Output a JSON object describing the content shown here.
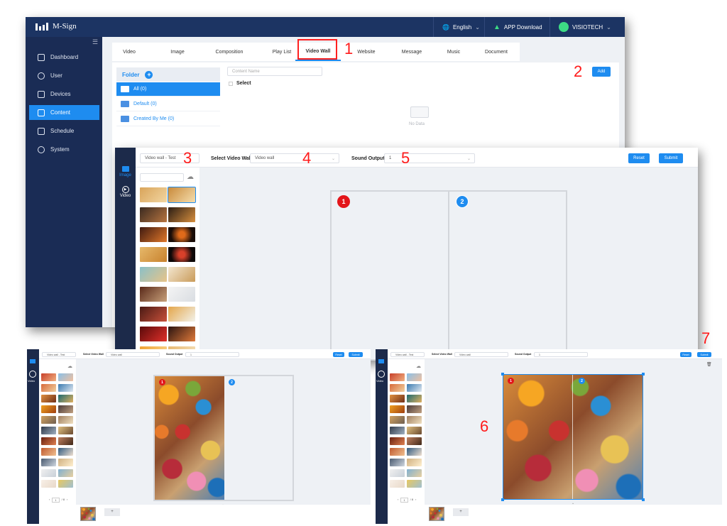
{
  "app": {
    "logo_text": "M-Sign",
    "language": "English",
    "app_download": "APP Download",
    "user": "VISIOTECH"
  },
  "sidebar": {
    "items": [
      {
        "label": "Dashboard",
        "icon": "grid-icon"
      },
      {
        "label": "User",
        "icon": "user-icon"
      },
      {
        "label": "Devices",
        "icon": "monitor-icon"
      },
      {
        "label": "Content",
        "icon": "image-icon"
      },
      {
        "label": "Schedule",
        "icon": "calendar-icon"
      },
      {
        "label": "System",
        "icon": "gear-icon"
      }
    ],
    "active": "Content"
  },
  "tabs": [
    "Video",
    "Image",
    "Composition",
    "Play List",
    "Video Wall",
    "Website",
    "Message",
    "Music",
    "Document"
  ],
  "active_tab": "Video Wall",
  "folder": {
    "title": "Folder",
    "rows": [
      "All  (0)",
      "Default  (0)",
      "Created By Me  (0)"
    ]
  },
  "content": {
    "search_placeholder": "Content Name",
    "select_label": "Select",
    "no_data": "No Data",
    "add_button": "Add"
  },
  "editor": {
    "name_value": "Video wall - Test",
    "select_wall_label": "Select Video Wall",
    "wall_value": "Video wall",
    "sound_label": "Sound Output",
    "sound_value": "1",
    "reset": "Reset",
    "submit": "Submit",
    "nav_image": "Image",
    "nav_video": "Video"
  },
  "badges": [
    "1",
    "2"
  ],
  "pagination": {
    "page": "1",
    "total": "/ 8"
  },
  "annotations": [
    "1",
    "2",
    "3",
    "4",
    "5",
    "6",
    "7"
  ],
  "colors": {
    "primary": "#1e8cf0",
    "nav": "#1c3463",
    "annotation": "#ff1a1a",
    "badge_red": "#e3151a"
  }
}
